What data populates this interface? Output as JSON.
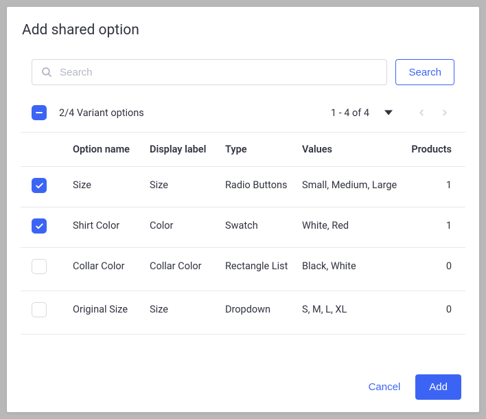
{
  "title": "Add shared option",
  "search": {
    "placeholder": "Search",
    "button_label": "Search"
  },
  "selection_summary": "2/4 Variant options",
  "pagination": "1 - 4 of 4",
  "columns": {
    "option_name": "Option name",
    "display_label": "Display label",
    "type": "Type",
    "values": "Values",
    "products": "Products"
  },
  "rows": [
    {
      "checked": true,
      "name": "Size",
      "label": "Size",
      "type": "Radio Buttons",
      "values": "Small, Medium, Large",
      "products": "1"
    },
    {
      "checked": true,
      "name": "Shirt Color",
      "label": "Color",
      "type": "Swatch",
      "values": "White, Red",
      "products": "1"
    },
    {
      "checked": false,
      "name": "Collar Color",
      "label": "Collar Color",
      "type": "Rectangle List",
      "values": "Black, White",
      "products": "0"
    },
    {
      "checked": false,
      "name": "Original Size",
      "label": "Size",
      "type": "Dropdown",
      "values": "S, M, L, XL",
      "products": "0"
    }
  ],
  "footer": {
    "cancel": "Cancel",
    "add": "Add"
  }
}
